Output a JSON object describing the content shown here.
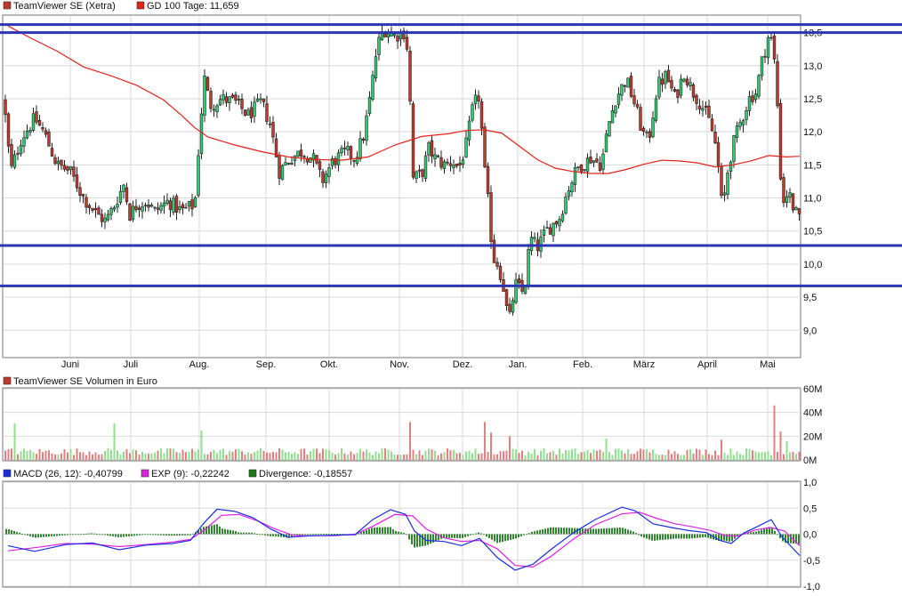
{
  "colors": {
    "price_up": "#2ecc71",
    "price_down": "#c0392b",
    "gd100": "#e3221a",
    "levels": "#2b35b5",
    "vol_up": "#8fe08f",
    "vol_down": "#e08080",
    "macd": "#1a2ee0",
    "exp": "#e020e0",
    "divergence": "#1a7a1a",
    "grid": "#d9d9d9",
    "frame": "#777777"
  },
  "panels": {
    "price": {
      "legend": [
        {
          "label": "TeamViewer SE (Xetra)",
          "swatch": "#c0392b"
        },
        {
          "label": "GD 100 Tage: 11,659",
          "swatch": "#e3221a"
        }
      ],
      "y_ticks": [
        "13,5",
        "13,0",
        "12,5",
        "12,0",
        "11,5",
        "11,0",
        "10,5",
        "10,0",
        "9,5",
        "9,0"
      ],
      "x_ticks": [
        "Juni",
        "Juli",
        "Aug.",
        "Sep.",
        "Okt.",
        "Nov.",
        "Dez.",
        "Jan.",
        "Feb.",
        "März",
        "April",
        "Mai"
      ]
    },
    "volume": {
      "legend": [
        {
          "label": "TeamViewer SE Volumen in Euro",
          "swatch": "#c0392b"
        }
      ],
      "y_ticks": [
        "60M",
        "40M",
        "20M",
        "0M"
      ]
    },
    "macd": {
      "legend": [
        {
          "label": "MACD (26, 12): -0,40799",
          "swatch": "#1a2ee0"
        },
        {
          "label": "EXP (9): -0,22242",
          "swatch": "#e020e0"
        },
        {
          "label": "Divergence: -0,18557",
          "swatch": "#1a7a1a"
        }
      ],
      "y_ticks": [
        "1,0",
        "0,5",
        "0,0",
        "-0,5",
        "-1,0"
      ]
    }
  },
  "chart_data": [
    {
      "type": "candlestick",
      "title": "TeamViewer SE (Xetra)",
      "ylim": [
        8.6,
        13.75
      ],
      "x_labels": [
        "Juni",
        "Juli",
        "Aug.",
        "Sep.",
        "Okt.",
        "Nov.",
        "Dez.",
        "Jan.",
        "Feb.",
        "März",
        "April",
        "Mai"
      ],
      "horizontal_lines": [
        13.62,
        13.5,
        10.28,
        9.67
      ],
      "price_path": [
        [
          0,
          12.5
        ],
        [
          8,
          11.4
        ],
        [
          20,
          11.9
        ],
        [
          35,
          12.2
        ],
        [
          45,
          12.0
        ],
        [
          60,
          11.5
        ],
        [
          75,
          11.4
        ],
        [
          90,
          11.0
        ],
        [
          105,
          10.75
        ],
        [
          115,
          10.65
        ],
        [
          125,
          10.9
        ],
        [
          135,
          11.2
        ],
        [
          142,
          10.75
        ],
        [
          150,
          10.9
        ],
        [
          160,
          10.95
        ],
        [
          170,
          10.8
        ],
        [
          185,
          10.95
        ],
        [
          200,
          10.8
        ],
        [
          215,
          10.9
        ],
        [
          221,
          12.1
        ],
        [
          226,
          12.8
        ],
        [
          232,
          12.4
        ],
        [
          245,
          12.5
        ],
        [
          260,
          12.45
        ],
        [
          275,
          12.25
        ],
        [
          290,
          12.45
        ],
        [
          300,
          12.1
        ],
        [
          310,
          11.4
        ],
        [
          322,
          11.6
        ],
        [
          335,
          11.7
        ],
        [
          348,
          11.6
        ],
        [
          358,
          11.25
        ],
        [
          370,
          11.55
        ],
        [
          385,
          11.7
        ],
        [
          395,
          11.6
        ],
        [
          405,
          11.95
        ],
        [
          413,
          12.6
        ],
        [
          420,
          13.3
        ],
        [
          428,
          13.55
        ],
        [
          440,
          13.45
        ],
        [
          450,
          13.5
        ],
        [
          455,
          13.2
        ],
        [
          460,
          11.3
        ],
        [
          470,
          11.35
        ],
        [
          478,
          11.75
        ],
        [
          485,
          11.6
        ],
        [
          495,
          11.5
        ],
        [
          505,
          11.55
        ],
        [
          512,
          11.45
        ],
        [
          520,
          11.8
        ],
        [
          528,
          12.4
        ],
        [
          535,
          12.55
        ],
        [
          540,
          11.5
        ],
        [
          545,
          10.9
        ],
        [
          550,
          10.1
        ],
        [
          556,
          10.0
        ],
        [
          562,
          9.65
        ],
        [
          568,
          9.1
        ],
        [
          575,
          9.7
        ],
        [
          585,
          9.55
        ],
        [
          592,
          10.4
        ],
        [
          600,
          10.25
        ],
        [
          610,
          10.5
        ],
        [
          625,
          10.7
        ],
        [
          635,
          11.15
        ],
        [
          645,
          11.45
        ],
        [
          660,
          11.6
        ],
        [
          672,
          11.5
        ],
        [
          680,
          12.1
        ],
        [
          688,
          12.5
        ],
        [
          700,
          12.8
        ],
        [
          710,
          12.4
        ],
        [
          718,
          12.0
        ],
        [
          725,
          11.85
        ],
        [
          735,
          12.7
        ],
        [
          745,
          12.85
        ],
        [
          755,
          12.5
        ],
        [
          765,
          12.9
        ],
        [
          775,
          12.6
        ],
        [
          785,
          12.4
        ],
        [
          795,
          12.1
        ],
        [
          802,
          11.7
        ],
        [
          808,
          10.8
        ],
        [
          815,
          11.5
        ],
        [
          822,
          11.9
        ],
        [
          830,
          12.2
        ],
        [
          838,
          12.5
        ],
        [
          846,
          12.6
        ],
        [
          853,
          13.1
        ],
        [
          860,
          13.45
        ],
        [
          865,
          13.35
        ],
        [
          870,
          12.4
        ],
        [
          875,
          10.9
        ],
        [
          882,
          11.1
        ],
        [
          888,
          10.85
        ],
        [
          895,
          10.65
        ]
      ],
      "moving_average_100": [
        [
          5,
          13.6
        ],
        [
          30,
          13.42
        ],
        [
          60,
          13.22
        ],
        [
          90,
          12.98
        ],
        [
          120,
          12.85
        ],
        [
          150,
          12.7
        ],
        [
          180,
          12.48
        ],
        [
          200,
          12.25
        ],
        [
          215,
          12.06
        ],
        [
          230,
          11.92
        ],
        [
          260,
          11.8
        ],
        [
          290,
          11.7
        ],
        [
          320,
          11.62
        ],
        [
          350,
          11.58
        ],
        [
          380,
          11.57
        ],
        [
          410,
          11.62
        ],
        [
          440,
          11.8
        ],
        [
          470,
          11.93
        ],
        [
          500,
          11.97
        ],
        [
          520,
          12.02
        ],
        [
          540,
          12.03
        ],
        [
          560,
          11.98
        ],
        [
          580,
          11.78
        ],
        [
          600,
          11.58
        ],
        [
          620,
          11.45
        ],
        [
          640,
          11.4
        ],
        [
          660,
          11.37
        ],
        [
          680,
          11.37
        ],
        [
          700,
          11.43
        ],
        [
          720,
          11.51
        ],
        [
          740,
          11.57
        ],
        [
          760,
          11.56
        ],
        [
          780,
          11.53
        ],
        [
          800,
          11.47
        ],
        [
          820,
          11.5
        ],
        [
          840,
          11.56
        ],
        [
          860,
          11.64
        ],
        [
          880,
          11.62
        ],
        [
          895,
          11.63
        ]
      ],
      "last_ma_value": 11.659
    },
    {
      "type": "bar",
      "title": "TeamViewer SE Volumen in Euro",
      "ylim": [
        0,
        60
      ],
      "unit": "M",
      "notable_spikes": [
        [
          12,
          31
        ],
        [
          125,
          31
        ],
        [
          222,
          25
        ],
        [
          456,
          32
        ],
        [
          540,
          32
        ],
        [
          548,
          23
        ],
        [
          568,
          20
        ],
        [
          678,
          18
        ],
        [
          808,
          17
        ],
        [
          868,
          46
        ],
        [
          872,
          24
        ],
        [
          882,
          16
        ]
      ]
    },
    {
      "type": "line",
      "title": "MACD",
      "ylim": [
        -1.0,
        1.0
      ],
      "series": [
        {
          "name": "MACD (26, 12)",
          "last": -0.40799,
          "points": [
            [
              5,
              -0.22
            ],
            [
              35,
              -0.33
            ],
            [
              70,
              -0.2
            ],
            [
              100,
              -0.17
            ],
            [
              130,
              -0.3
            ],
            [
              160,
              -0.21
            ],
            [
              190,
              -0.18
            ],
            [
              210,
              -0.12
            ],
            [
              225,
              0.21
            ],
            [
              240,
              0.48
            ],
            [
              260,
              0.44
            ],
            [
              280,
              0.32
            ],
            [
              300,
              0.1
            ],
            [
              320,
              -0.06
            ],
            [
              345,
              -0.03
            ],
            [
              370,
              -0.02
            ],
            [
              395,
              -0.01
            ],
            [
              415,
              0.28
            ],
            [
              435,
              0.47
            ],
            [
              452,
              0.38
            ],
            [
              462,
              0.06
            ],
            [
              475,
              -0.12
            ],
            [
              495,
              -0.14
            ],
            [
              515,
              -0.22
            ],
            [
              535,
              -0.08
            ],
            [
              555,
              -0.45
            ],
            [
              575,
              -0.69
            ],
            [
              595,
              -0.58
            ],
            [
              615,
              -0.3
            ],
            [
              640,
              0.02
            ],
            [
              665,
              0.28
            ],
            [
              695,
              0.52
            ],
            [
              710,
              0.45
            ],
            [
              730,
              0.2
            ],
            [
              750,
              0.13
            ],
            [
              770,
              0.07
            ],
            [
              790,
              0.03
            ],
            [
              805,
              -0.12
            ],
            [
              818,
              -0.18
            ],
            [
              832,
              0.02
            ],
            [
              848,
              0.15
            ],
            [
              863,
              0.28
            ],
            [
              875,
              -0.05
            ],
            [
              895,
              -0.41
            ]
          ]
        },
        {
          "name": "EXP (9)",
          "last": -0.22242,
          "points": [
            [
              5,
              -0.32
            ],
            [
              35,
              -0.26
            ],
            [
              70,
              -0.18
            ],
            [
              100,
              -0.19
            ],
            [
              130,
              -0.24
            ],
            [
              160,
              -0.2
            ],
            [
              190,
              -0.15
            ],
            [
              210,
              -0.1
            ],
            [
              225,
              0.07
            ],
            [
              245,
              0.36
            ],
            [
              265,
              0.38
            ],
            [
              285,
              0.26
            ],
            [
              305,
              0.1
            ],
            [
              325,
              -0.02
            ],
            [
              345,
              -0.03
            ],
            [
              370,
              -0.03
            ],
            [
              395,
              0.0
            ],
            [
              415,
              0.15
            ],
            [
              440,
              0.38
            ],
            [
              460,
              0.35
            ],
            [
              475,
              0.1
            ],
            [
              495,
              -0.07
            ],
            [
              515,
              -0.14
            ],
            [
              535,
              -0.12
            ],
            [
              555,
              -0.28
            ],
            [
              575,
              -0.6
            ],
            [
              595,
              -0.63
            ],
            [
              615,
              -0.43
            ],
            [
              640,
              -0.1
            ],
            [
              665,
              0.18
            ],
            [
              695,
              0.39
            ],
            [
              715,
              0.42
            ],
            [
              735,
              0.3
            ],
            [
              755,
              0.2
            ],
            [
              775,
              0.14
            ],
            [
              795,
              0.07
            ],
            [
              810,
              -0.02
            ],
            [
              825,
              -0.04
            ],
            [
              845,
              0.08
            ],
            [
              862,
              0.13
            ],
            [
              878,
              0.06
            ],
            [
              895,
              -0.22
            ]
          ]
        },
        {
          "name": "Divergence",
          "last": -0.18557,
          "type": "histogram"
        }
      ]
    }
  ]
}
